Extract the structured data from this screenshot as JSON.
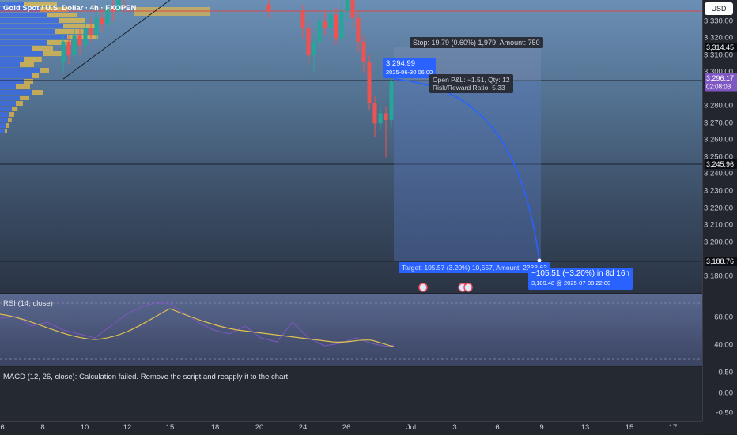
{
  "header": {
    "symbol_title": "Gold Spot / U.S. Dollar · 4h · FXOPEN",
    "currency_button": "USD"
  },
  "price_axis": {
    "labels": [
      "3,330.00",
      "3,320.00",
      "3,310.00",
      "3,300.00",
      "3,280.00",
      "3,270.00",
      "3,260.00",
      "3,250.00",
      "3,240.00",
      "3,230.00",
      "3,220.00",
      "3,210.00",
      "3,200.00",
      "3,180.00"
    ],
    "tags": {
      "stop_price": "3,314.45",
      "current_price": "3,296.17",
      "countdown": "02:08:03",
      "horizontal_line": "3,245.96",
      "target_price": "3,188.76"
    }
  },
  "rsi_axis": {
    "labels": [
      "60.00",
      "40.00"
    ]
  },
  "macd_axis": {
    "labels": [
      "0.50",
      "0.00",
      "-0.50"
    ]
  },
  "time_axis": {
    "labels": [
      "6",
      "8",
      "10",
      "12",
      "15",
      "18",
      "20",
      "24",
      "26",
      "Jul",
      "3",
      "6",
      "9",
      "13",
      "15",
      "17"
    ]
  },
  "position": {
    "stop_label": "Stop: 19.79 (0.60%) 1,979, Amount: 750",
    "entry_price": "3,294.99",
    "entry_time": "2025-06-30 06:00",
    "open_pnl": "Open P&L: −1.51, Qty: 12",
    "risk_reward": "Risk/Reward Ratio: 5.33",
    "target_label": "Target: 105.57 (3.20%) 10,557, Amount: 2333.63",
    "projection_main": "−105.51 (−3.20%) in 8d 16h",
    "projection_sub": "3,189.48 @ 2025-07-08  22:00"
  },
  "indicators": {
    "rsi_title": "RSI (14, close)",
    "macd_title": "MACD (12, 26, close): Calculation failed. Remove the script and reapply it to the chart."
  },
  "colors": {
    "bull": "#26a69a",
    "bear": "#ef5350",
    "projection": "#2962ff",
    "rsi_line": "#7e57c2",
    "rsi_ma": "#e0c050",
    "current_tag": "#7e57c2"
  }
}
